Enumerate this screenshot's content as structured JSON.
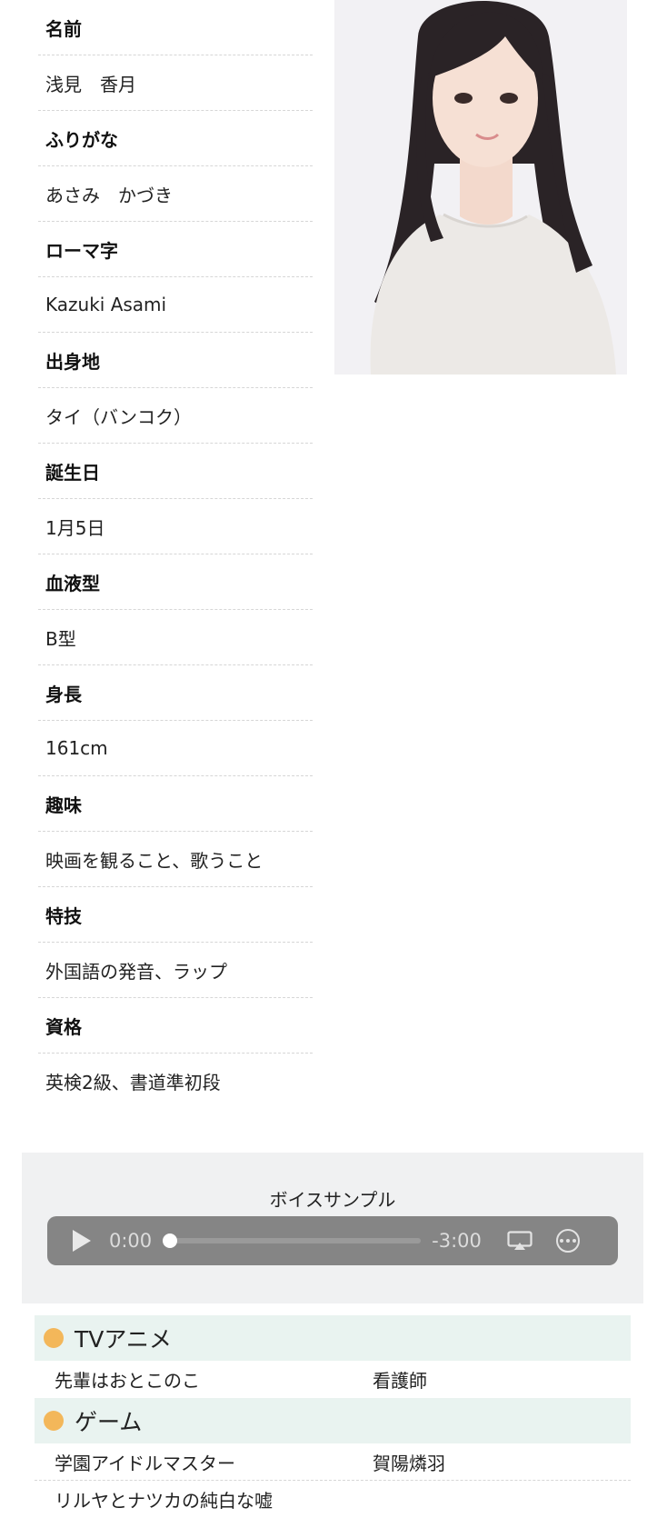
{
  "profile": [
    {
      "label": "名前",
      "value": "浅見　香月"
    },
    {
      "label": "ふりがな",
      "value": "あさみ　かづき"
    },
    {
      "label": "ローマ字",
      "value": "Kazuki Asami"
    },
    {
      "label": "出身地",
      "value": "タイ（バンコク）"
    },
    {
      "label": "誕生日",
      "value": "1月5日"
    },
    {
      "label": "血液型",
      "value": "B型"
    },
    {
      "label": "身長",
      "value": "161cm"
    },
    {
      "label": "趣味",
      "value": "映画を観ること、歌うこと"
    },
    {
      "label": "特技",
      "value": "外国語の発音、ラップ"
    },
    {
      "label": "資格",
      "value": "英検2級、書道準初段"
    }
  ],
  "voice": {
    "title": "ボイスサンプル",
    "current_time": "0:00",
    "remaining_time": "-3:00",
    "progress": 0
  },
  "works": {
    "tv_anime": {
      "title": "TVアニメ",
      "items": [
        {
          "title": "先輩はおとこのこ",
          "role": "看護師"
        }
      ]
    },
    "game": {
      "title": "ゲーム",
      "items": [
        {
          "title": "学園アイドルマスター",
          "role": "賀陽燐羽"
        },
        {
          "title": "リルヤとナツカの純白な嘘",
          "role": ""
        }
      ]
    }
  },
  "colors": {
    "section_bg": "#e9f3f0",
    "bullet": "#f3b75a",
    "player_bg": "#858585",
    "panel_bg": "#f0f1f2"
  }
}
